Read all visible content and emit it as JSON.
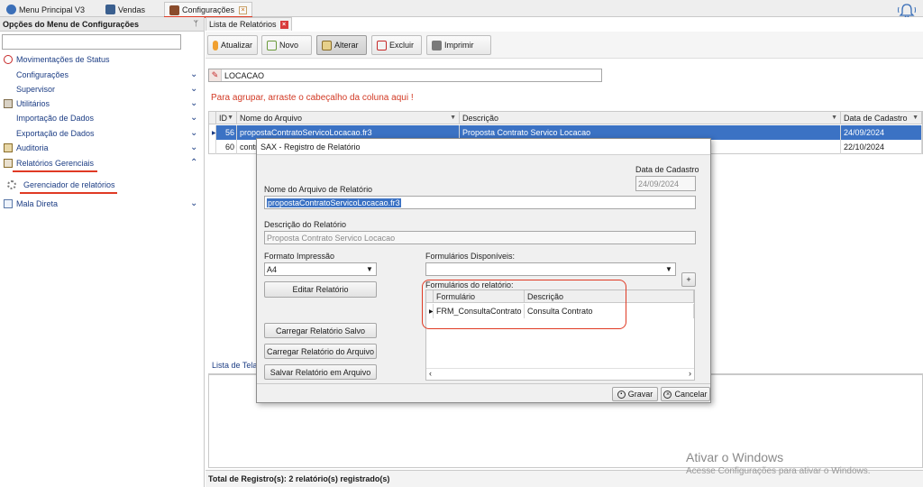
{
  "top_tabs": [
    {
      "label": "Menu Principal V3",
      "icon": "app-icon"
    },
    {
      "label": "Vendas",
      "icon": "app-icon"
    },
    {
      "label": "Configurações",
      "icon": "settings-icon"
    }
  ],
  "left_panel": {
    "title": "Opções do Menu de Configurações",
    "items": [
      {
        "label": "Movimentações de Status",
        "icon": "alert-icon"
      },
      {
        "label": "Configurações"
      },
      {
        "label": "Supervisor"
      },
      {
        "label": "Utilitários",
        "icon": "tools-icon"
      },
      {
        "label": "Importação de Dados"
      },
      {
        "label": "Exportação de Dados"
      },
      {
        "label": "Auditoria",
        "icon": "audit-icon"
      },
      {
        "label": "Relatórios Gerenciais",
        "icon": "report-icon"
      },
      {
        "label": "Gerenciador de relatórios",
        "icon": "gear-icon"
      },
      {
        "label": "Mala Direta",
        "icon": "mail-icon"
      }
    ]
  },
  "content": {
    "tab_label": "Lista de Relatórios",
    "toolbar": {
      "refresh": "Atualizar",
      "new": "Novo",
      "edit": "Alterar",
      "delete": "Excluir",
      "print": "Imprimir"
    },
    "filter_value": "LOCACAO",
    "group_hint": "Para agrupar, arraste o cabeçalho da coluna aqui !",
    "grid": {
      "columns": [
        "ID",
        "Nome do Arquivo",
        "Descrição",
        "Data de Cadastro"
      ],
      "rows": [
        {
          "id": "56",
          "file": "propostaContratoServicoLocacao.fr3",
          "desc": "Proposta Contrato Servico Locacao",
          "date": "24/09/2024"
        },
        {
          "id": "60",
          "file": "contr",
          "desc": "",
          "date": "22/10/2024"
        }
      ]
    },
    "bottom_tab": "Lista de Tela",
    "footer": "Total de Registro(s): 2 relatório(s) registrado(s)"
  },
  "dialog": {
    "title": "SAX - Registro de Relatório",
    "date_label": "Data de Cadastro",
    "date_value": "24/09/2024",
    "file_label": "Nome do Arquivo de Relatório",
    "file_value": "propostaContratoServicoLocacao.fr3",
    "desc_label": "Descrição do Relatório",
    "desc_value": "Proposta Contrato Servico Locacao",
    "format_label": "Formato Impressão",
    "format_value": "A4",
    "forms_available_label": "Formulários Disponíveis:",
    "forms_available_value": "",
    "add_label": "+",
    "edit_report": "Editar Relatório",
    "forms_label": "Formulários do relatório:",
    "forms_columns": [
      "Formulário",
      "Descrição"
    ],
    "forms_rows": [
      {
        "form": "FRM_ConsultaContrato",
        "desc": "Consulta Contrato"
      }
    ],
    "load_saved": "Carregar Relatório Salvo",
    "load_file": "Carregar Relatório do Arquivo",
    "save_file": "Salvar Relatório em Arquivo",
    "save": "Gravar",
    "cancel": "Cancelar"
  },
  "watermark": {
    "line1": "Ativar o Windows",
    "line2": "Acesse Configurações para ativar o Windows."
  },
  "colors": {
    "selection": "#3b72c4",
    "menu_text": "#1c3d84",
    "hint_red": "#d23a25",
    "annotation_red": "#e03a24"
  }
}
